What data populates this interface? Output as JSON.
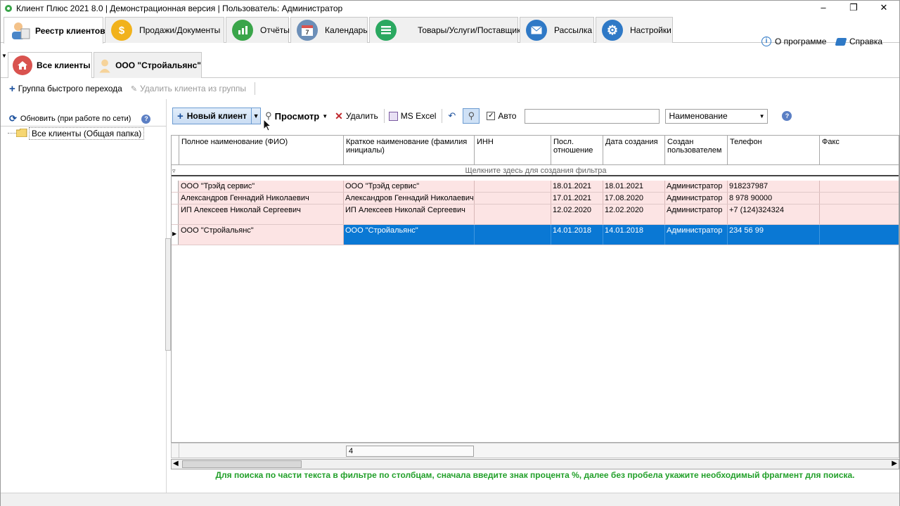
{
  "window": {
    "title": "Клиент Плюс 2021 8.0 | Демонстрационная версия | Пользователь: Администратор"
  },
  "main_tabs": [
    {
      "label": "Реестр клиентов",
      "icon": "clients-icon",
      "color": "#4a86c8",
      "active": true
    },
    {
      "label": "Продажи/Документы",
      "icon": "dollar-icon",
      "color": "#f1b21c"
    },
    {
      "label": "Отчёты",
      "icon": "chart-icon",
      "color": "#3aa54a"
    },
    {
      "label": "Календарь",
      "icon": "calendar-icon",
      "color": "#6c8fb8"
    },
    {
      "label": "Товары/Услуги/Поставщики",
      "icon": "list-icon",
      "color": "#2aa860"
    },
    {
      "label": "Рассылка",
      "icon": "mail-icon",
      "color": "#2f79c6"
    },
    {
      "label": "Настройки",
      "icon": "gear-icon",
      "color": "#2f79c6"
    }
  ],
  "top_links": {
    "about": "О программе",
    "help": "Справка"
  },
  "sub_tabs": [
    {
      "label": "Все клиенты",
      "icon": "home-icon",
      "active": true
    },
    {
      "label": "ООО \"Стройальянс\"",
      "icon": "person-icon"
    }
  ],
  "group_bar": {
    "quick_group": "Группа быстрого перехода",
    "remove_from_group": "Удалить клиента из группы"
  },
  "left": {
    "refresh": "Обновить (при работе по сети)",
    "tree_root": "Все клиенты (Общая папка)"
  },
  "toolbar": {
    "new_client": "Новый клиент",
    "view": "Просмотр",
    "delete": "Удалить",
    "excel": "MS Excel",
    "auto": "Авто",
    "auto_checked": true,
    "search_value": "",
    "field_select": "Наименование"
  },
  "grid": {
    "columns": [
      "Полное наименование (ФИО)",
      "Краткое наименование (фамилия инициалы)",
      "ИНН",
      "Посл. отношение",
      "Дата создания",
      "Создан пользователем",
      "Телефон",
      "Факс"
    ],
    "filter_hint": "Щелкните здесь для создания фильтра",
    "rows": [
      [
        "ООО \"Трэйд сервис\"",
        "ООО \"Трэйд сервис\"",
        "",
        "18.01.2021",
        "18.01.2021",
        "Администратор",
        "918237987",
        ""
      ],
      [
        "Александров Геннадий Николаевич",
        "Александров Геннадий Николаевич",
        "",
        "17.01.2021",
        "17.08.2020",
        "Администратор",
        "8 978 90000",
        ""
      ],
      [
        "ИП Алексеев Николай Сергеевич",
        "ИП Алексеев Николай Сергеевич",
        "",
        "12.02.2020",
        "12.02.2020",
        "Администратор",
        "+7 (124)324324",
        ""
      ],
      [
        "ООО \"Стройальянс\"",
        "ООО \"Стройальянс\"",
        "",
        "14.01.2018",
        "14.01.2018",
        "Администратор",
        "234 56 99",
        ""
      ]
    ],
    "count": "4"
  },
  "hint": "Для поиска по части текста в фильтре по столбцам, сначала введите знак процента %, далее без пробела укажите необходимый фрагмент для поиска."
}
